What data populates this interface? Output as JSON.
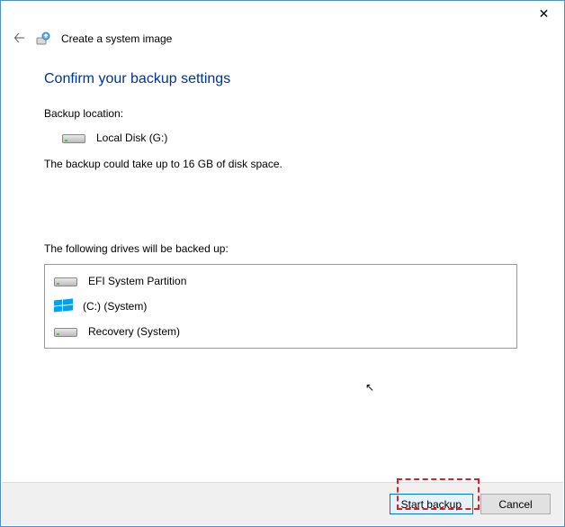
{
  "window": {
    "title": "Create a system image"
  },
  "heading": "Confirm your backup settings",
  "backup_location_label": "Backup location:",
  "backup_location_value": "Local Disk (G:)",
  "size_note": "The backup could take up to 16 GB of disk space.",
  "drives_label": "The following drives will be backed up:",
  "drives": [
    {
      "icon": "drive",
      "name": "EFI System Partition"
    },
    {
      "icon": "windows",
      "name": "(C:) (System)"
    },
    {
      "icon": "drive",
      "name": "Recovery (System)"
    }
  ],
  "buttons": {
    "start": "Start backup",
    "cancel": "Cancel"
  }
}
